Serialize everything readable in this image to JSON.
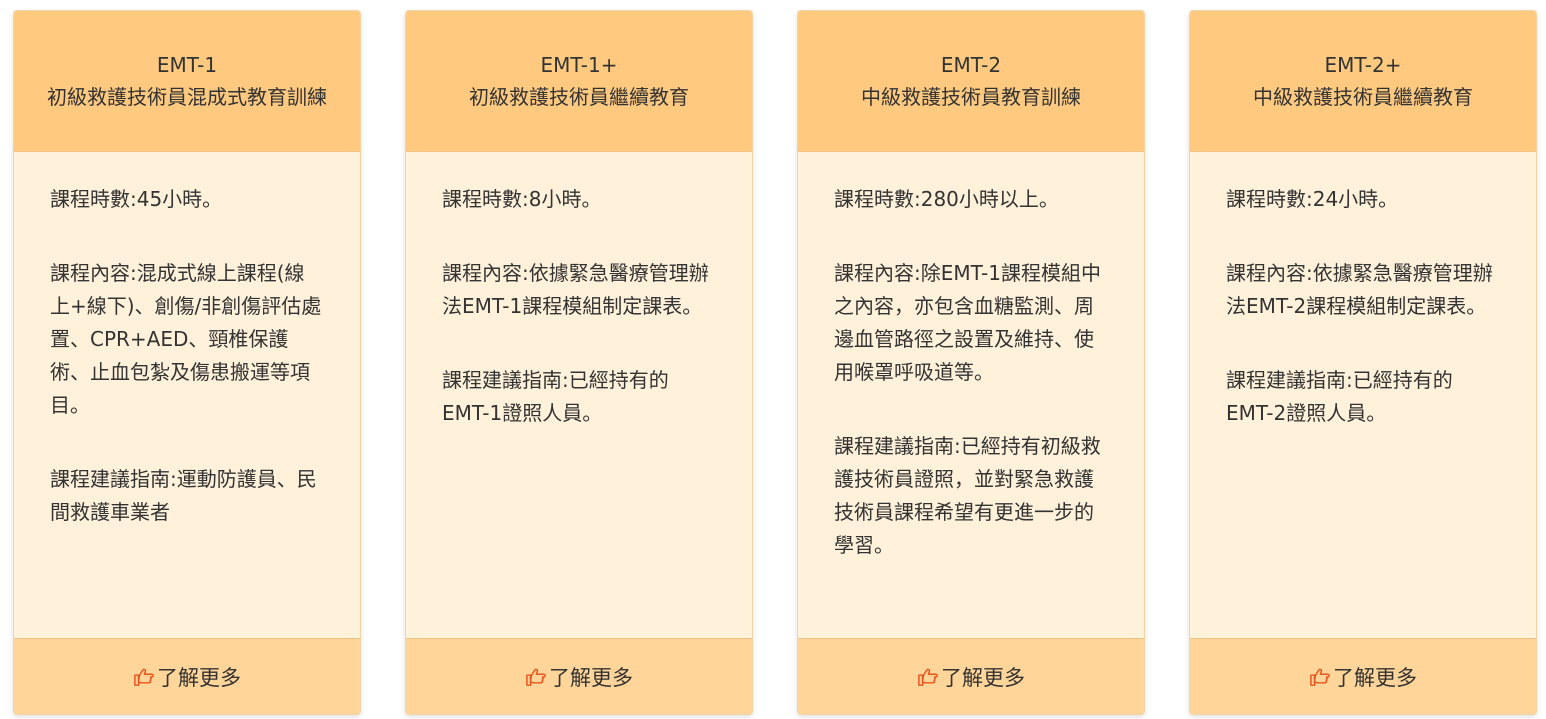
{
  "colors": {
    "header_bg": "#ffca80",
    "body_bg": "#fff1da",
    "footer_bg": "#ffd59a",
    "icon": "#e8541b"
  },
  "cards": [
    {
      "code": "EMT-1",
      "title": "初級救護技術員混成式教育訓練",
      "paragraphs": [
        "課程時數:45小時。",
        "課程內容:混成式線上課程(線上+線下)、創傷/非創傷評估處置、CPR+AED、頸椎保護術、止血包紮及傷患搬運等項目。",
        "課程建議指南:運動防護員、民間救護車業者"
      ],
      "footer_icon": "hand-pointing-right-icon",
      "footer_label": "了解更多"
    },
    {
      "code": "EMT-1+",
      "title": "初級救護技術員繼續教育",
      "paragraphs": [
        "課程時數:8小時。",
        "課程內容:依據緊急醫療管理辦法EMT-1課程模組制定課表。",
        "課程建議指南:已經持有的EMT-1證照人員。"
      ],
      "footer_icon": "hand-pointing-right-icon",
      "footer_label": "了解更多"
    },
    {
      "code": "EMT-2",
      "title": "中級救護技術員教育訓練",
      "paragraphs": [
        "課程時數:280小時以上。",
        "課程內容:除EMT-1課程模組中之內容，亦包含血糖監測、周邊血管路徑之設置及維持、使用喉罩呼吸道等。",
        "課程建議指南:已經持有初級救護技術員證照，並對緊急救護技術員課程希望有更進一步的學習。"
      ],
      "footer_icon": "hand-pointing-right-icon",
      "footer_label": "了解更多"
    },
    {
      "code": "EMT-2+",
      "title": "中級救護技術員繼續教育",
      "paragraphs": [
        "課程時數:24小時。",
        "課程內容:依據緊急醫療管理辦法EMT-2課程模組制定課表。",
        "課程建議指南:已經持有的EMT-2證照人員。"
      ],
      "footer_icon": "hand-pointing-right-icon",
      "footer_label": "了解更多"
    }
  ]
}
